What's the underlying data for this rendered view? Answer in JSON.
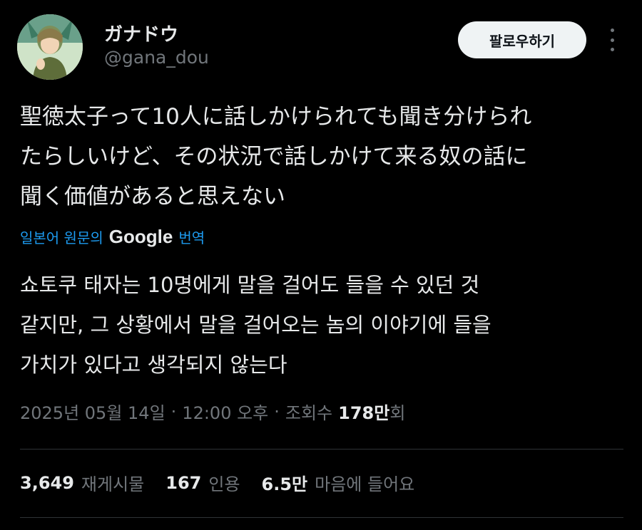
{
  "author": {
    "display_name": "ガナドウ",
    "handle": "@gana_dou"
  },
  "follow_button": {
    "label": "팔로우하기"
  },
  "more_icon": "more-vertical-icon",
  "tweet": {
    "text": "聖徳太子って10人に話しかけられても聞き分けられ\nたらしいけど、その状況で話しかけて来る奴の話に\n聞く価値があると思えない"
  },
  "translation": {
    "source_label": "일본어 원문의",
    "provider": "Google",
    "action_label": "번역",
    "text": "쇼토쿠 태자는 10명에게 말을 걸어도 들을 수 있던 것\n같지만, 그 상황에서 말을 걸어오는 놈의 이야기에 들을\n가치가 있다고 생각되지 않는다"
  },
  "meta": {
    "date": "2025년 05월 14일",
    "time": "12:00 오후",
    "views_label": "조회수",
    "views_number": "178만",
    "views_suffix": "회",
    "separator": "·"
  },
  "stats": [
    {
      "number": "3,649",
      "label": "재게시물"
    },
    {
      "number": "167",
      "label": "인용"
    },
    {
      "number": "6.5만",
      "label": "마음에 들어요"
    }
  ],
  "colors": {
    "background": "#000000",
    "text": "#e7e9ea",
    "muted": "#71767b",
    "link": "#1d9bf0",
    "button_bg": "#eff3f4",
    "divider": "#2f3336"
  }
}
